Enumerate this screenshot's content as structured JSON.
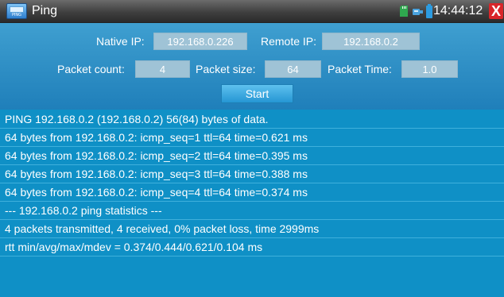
{
  "window": {
    "title": "Ping",
    "app_icon_label": "PING",
    "time": "14:44:12",
    "close_glyph": "X",
    "status_icons": [
      "sd-card-icon",
      "network-cable-icon",
      "battery-icon"
    ]
  },
  "form": {
    "native_ip_label": "Native IP:",
    "native_ip_value": "192.168.0.226",
    "remote_ip_label": "Remote IP:",
    "remote_ip_value": "192.168.0.2",
    "packet_count_label": "Packet count:",
    "packet_count_value": "4",
    "packet_size_label": "Packet size:",
    "packet_size_value": "64",
    "packet_time_label": "Packet Time:",
    "packet_time_value": "1.0",
    "start_label": "Start"
  },
  "output": {
    "lines": [
      "PING 192.168.0.2 (192.168.0.2) 56(84) bytes of data.",
      "64 bytes from 192.168.0.2: icmp_seq=1 ttl=64 time=0.621 ms",
      "64 bytes from 192.168.0.2: icmp_seq=2 ttl=64 time=0.395 ms",
      "64 bytes from 192.168.0.2: icmp_seq=3 ttl=64 time=0.388 ms",
      "64 bytes from 192.168.0.2: icmp_seq=4 ttl=64 time=0.374 ms",
      "--- 192.168.0.2 ping statistics ---",
      "4 packets transmitted, 4 received, 0% packet loss, time 2999ms",
      "rtt min/avg/max/mdev = 0.374/0.444/0.621/0.104 ms"
    ]
  },
  "colors": {
    "background": "#0f90c6",
    "title_bar": "#3f3f3f",
    "close": "#d9262a",
    "field": "#9fc3d6"
  }
}
